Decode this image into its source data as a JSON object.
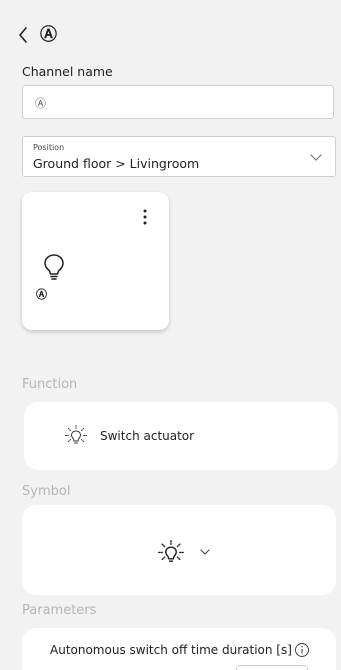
{
  "header": {
    "title": "Ⓐ"
  },
  "channel": {
    "label": "Channel name",
    "value": "Ⓐ"
  },
  "position": {
    "small_label": "Position",
    "value": "Ground floor > Livingroom"
  },
  "tile": {
    "letter": "Ⓐ"
  },
  "function": {
    "section_label": "Function",
    "value": "Switch actuator"
  },
  "symbol": {
    "section_label": "Symbol"
  },
  "parameters": {
    "section_label": "Parameters",
    "item_label": "Autonomous switch off time duration [s]"
  }
}
